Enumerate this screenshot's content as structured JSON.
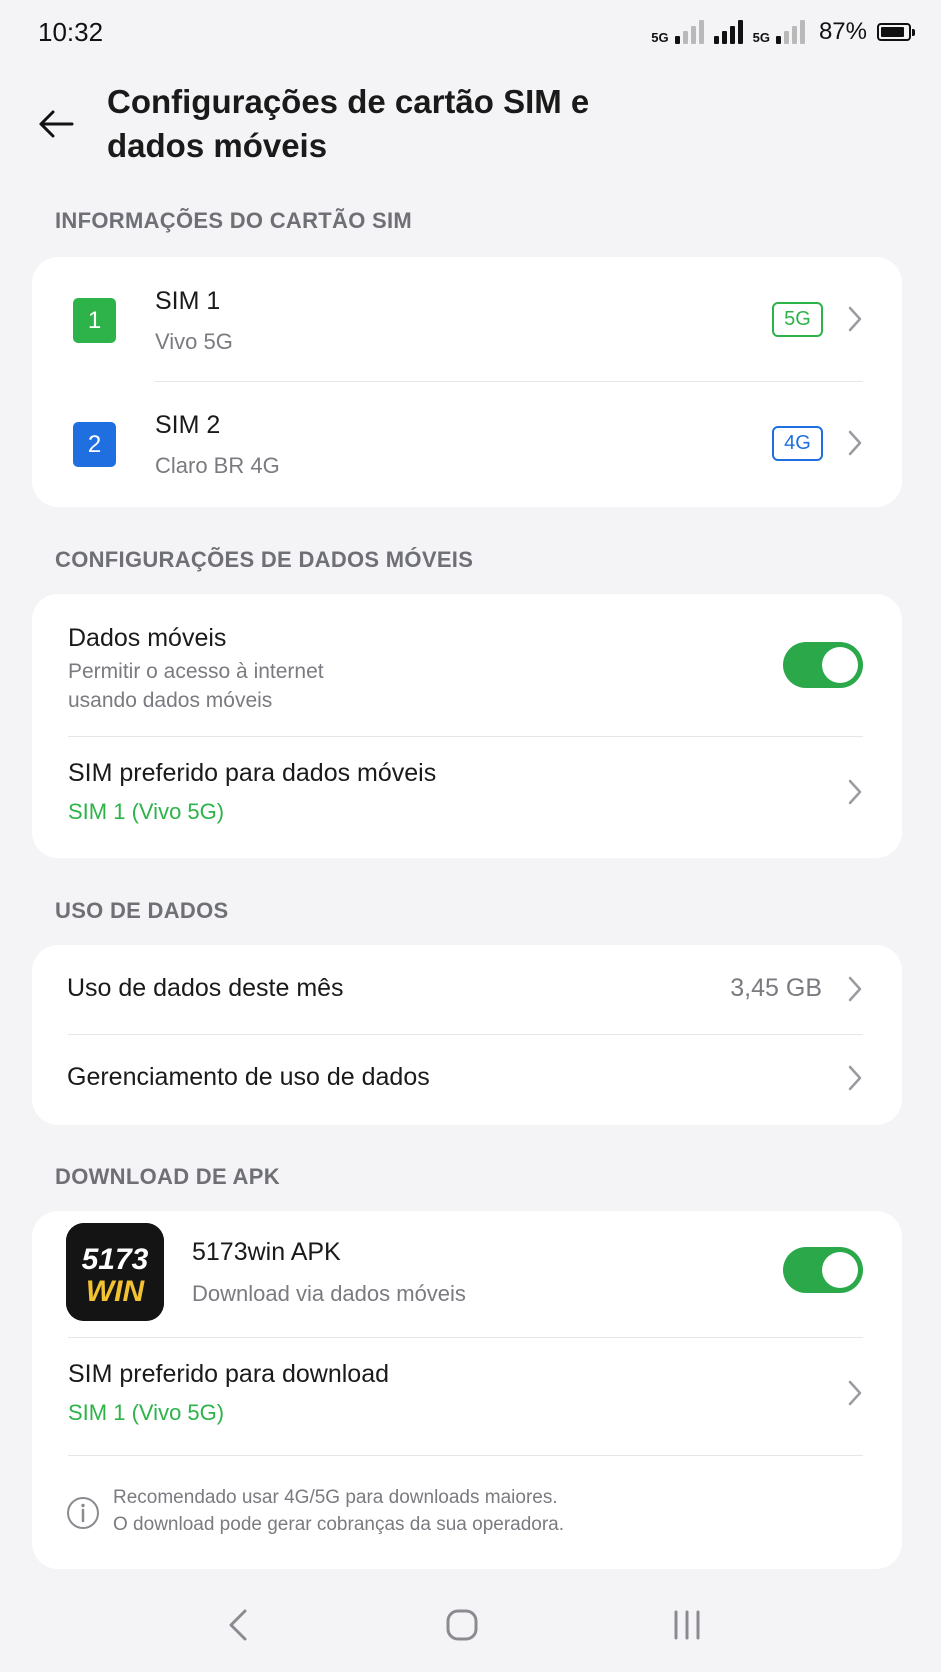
{
  "status": {
    "time": "10:32",
    "net1": "5G",
    "net2": "5G",
    "battery_pct": "87%",
    "battery_level": 0.87
  },
  "header": {
    "title_line1": "Configurações de cartão SIM e",
    "title_line2": "dados móveis"
  },
  "sim_info": {
    "label": "INFORMAÇÕES DO CARTÃO SIM",
    "sims": [
      {
        "badge": "1",
        "name": "SIM 1",
        "carrier": "Vivo 5G",
        "network": "5G",
        "color": "#2db34a"
      },
      {
        "badge": "2",
        "name": "SIM 2",
        "carrier": "Claro BR 4G",
        "network": "4G",
        "color": "#1f6fe0"
      }
    ]
  },
  "mobile_data": {
    "label": "CONFIGURAÇÕES DE DADOS MÓVEIS",
    "toggle_title": "Dados móveis",
    "toggle_sub_line1": "Permitir o acesso à internet",
    "toggle_sub_line2": "usando dados móveis",
    "toggle_on": true,
    "preferred_title": "SIM preferido para dados móveis",
    "preferred_value": "SIM 1 (Vivo 5G)"
  },
  "data_usage": {
    "label": "USO DE DADOS",
    "monthly_title": "Uso de dados deste mês",
    "monthly_value": "3,45 GB",
    "management_title": "Gerenciamento de uso de dados"
  },
  "apk": {
    "label": "DOWNLOAD DE APK",
    "logo_top": "5173",
    "logo_bottom": "WIN",
    "app_name": "5173win APK",
    "app_sub": "Download via dados móveis",
    "toggle_on": true,
    "preferred_title": "SIM preferido para download",
    "preferred_value": "SIM 1 (Vivo 5G)",
    "note_line1": "Recomendado usar 4G/5G para downloads maiores.",
    "note_line2": "O download pode gerar cobranças da sua operadora."
  },
  "colors": {
    "accent_green": "#2db34a",
    "sim2_blue": "#1f6fe0",
    "toggle_green": "#2aa84a"
  }
}
